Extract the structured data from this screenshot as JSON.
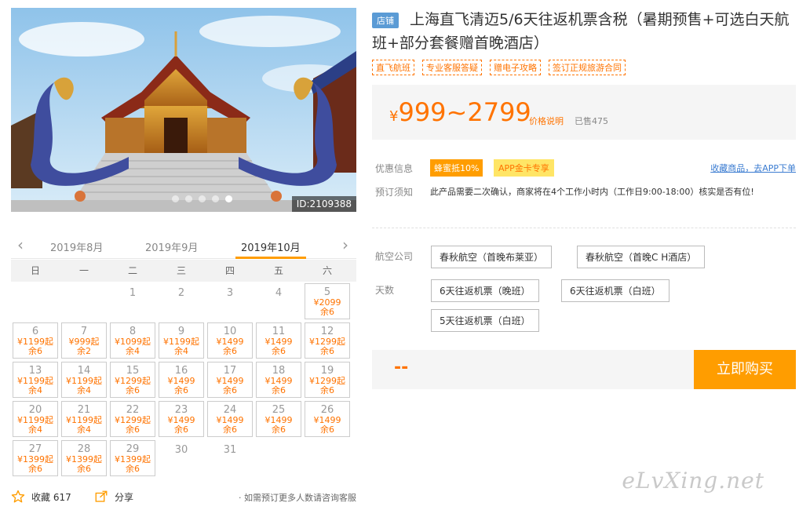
{
  "photo": {
    "id_label": "ID:2109388",
    "dots": 5,
    "active_dot": 4
  },
  "calendar": {
    "months": [
      "2019年8月",
      "2019年9月",
      "2019年10月"
    ],
    "active_month": 2,
    "weekdays": [
      "日",
      "一",
      "二",
      "三",
      "四",
      "五",
      "六"
    ],
    "leading_blank": 2,
    "days": [
      {
        "d": "1"
      },
      {
        "d": "2"
      },
      {
        "d": "3"
      },
      {
        "d": "4"
      },
      {
        "d": "5",
        "p": "¥2099",
        "s": "余6"
      },
      {
        "d": "6",
        "p": "¥1199起",
        "s": "余6"
      },
      {
        "d": "7",
        "p": "¥999起",
        "s": "余2"
      },
      {
        "d": "8",
        "p": "¥1099起",
        "s": "余4"
      },
      {
        "d": "9",
        "p": "¥1199起",
        "s": "余4"
      },
      {
        "d": "10",
        "p": "¥1499",
        "s": "余6"
      },
      {
        "d": "11",
        "p": "¥1499",
        "s": "余6"
      },
      {
        "d": "12",
        "p": "¥1299起",
        "s": "余6"
      },
      {
        "d": "13",
        "p": "¥1199起",
        "s": "余4"
      },
      {
        "d": "14",
        "p": "¥1199起",
        "s": "余4"
      },
      {
        "d": "15",
        "p": "¥1299起",
        "s": "余6"
      },
      {
        "d": "16",
        "p": "¥1499",
        "s": "余6"
      },
      {
        "d": "17",
        "p": "¥1499",
        "s": "余6"
      },
      {
        "d": "18",
        "p": "¥1499",
        "s": "余6"
      },
      {
        "d": "19",
        "p": "¥1299起",
        "s": "余6"
      },
      {
        "d": "20",
        "p": "¥1199起",
        "s": "余4"
      },
      {
        "d": "21",
        "p": "¥1199起",
        "s": "余4"
      },
      {
        "d": "22",
        "p": "¥1299起",
        "s": "余6"
      },
      {
        "d": "23",
        "p": "¥1499",
        "s": "余6"
      },
      {
        "d": "24",
        "p": "¥1499",
        "s": "余6"
      },
      {
        "d": "25",
        "p": "¥1499",
        "s": "余6"
      },
      {
        "d": "26",
        "p": "¥1499",
        "s": "余6"
      },
      {
        "d": "27",
        "p": "¥1399起",
        "s": "余6"
      },
      {
        "d": "28",
        "p": "¥1399起",
        "s": "余6"
      },
      {
        "d": "29",
        "p": "¥1399起",
        "s": "余6"
      },
      {
        "d": "30"
      },
      {
        "d": "31"
      }
    ]
  },
  "footer": {
    "fav_label": "收藏 617",
    "share_label": "分享",
    "consult": "· 如需预订更多人数请咨询客服"
  },
  "product": {
    "shop_badge": "店铺",
    "title": "上海直飞清迈5/6天往返机票含税（暑期预售+可选白天航班+部分套餐赠首晚酒店）",
    "tags": [
      "直飞航班",
      "专业客服答疑",
      "赠电子攻略",
      "签订正规旅游合同"
    ],
    "price_yen": "¥",
    "price_range": "999~2799",
    "price_note": "价格说明",
    "sold": "已售475",
    "promo_label": "优惠信息",
    "promo_badges": [
      "蜂蜜抵10%",
      "APP金卡专享"
    ],
    "fav_link": "收藏商品，去APP下单",
    "notice_label": "预订须知",
    "notice_text": "此产品需要二次确认，商家将在4个工作小时内（工作日9:00-18:00）核实是否有位!",
    "airline_label": "航空公司",
    "airline_options": [
      "春秋航空（首晚布莱亚）",
      "春秋航空（首晚C H酒店）"
    ],
    "days_label": "天数",
    "days_options": [
      "6天往返机票（晚班）",
      "6天往返机票（白班）",
      "5天往返机票（白班）"
    ],
    "selected_price": "--",
    "buy_label": "立即购买"
  },
  "watermark": "eLvXing.net",
  "colors": {
    "accent": "#ff9d00",
    "price": "#ff7300",
    "link": "#3b7cd1",
    "shop_badge": "#5b9bd5"
  }
}
